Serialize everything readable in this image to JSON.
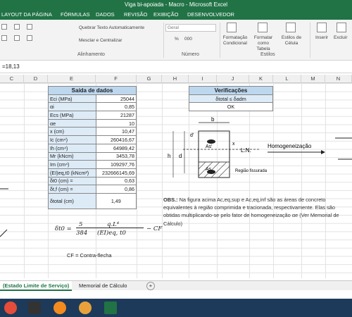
{
  "window": {
    "title": "Viga bi-apoiada - Macro - Microsoft Excel"
  },
  "tabs": [
    "LAYOUT DA PÁGINA",
    "FÓRMULAS",
    "DADOS",
    "REVISÃO",
    "EXIBIÇÃO",
    "DESENVOLVEDOR"
  ],
  "ribbon": {
    "wrap_text": "Quebrar Texto Automaticamente",
    "merge_center": "Mesclar e Centralizar",
    "number_format": "Geral",
    "alignment_group": "Alinhamento",
    "number_group": "Número",
    "conditional_format": "Formatação Condicional",
    "format_as_table": "Formatar como Tabela",
    "cell_styles": "Estilos de Célula",
    "insert": "Inserir",
    "delete": "Excluir",
    "styles_group": "Estilos",
    "percent": "%",
    "thousands": "000"
  },
  "formula": {
    "value": "=18,13"
  },
  "columns": [
    "C",
    "D",
    "E",
    "F",
    "G",
    "H",
    "I",
    "J",
    "K",
    "L",
    "M",
    "N"
  ],
  "output": {
    "title": "Saída de dados",
    "rows": [
      {
        "label": "Eci (MPa)",
        "value": "25044"
      },
      {
        "label": "αi",
        "value": "0,85"
      },
      {
        "label": "Ecs (MPa)",
        "value": "21287"
      },
      {
        "label": "αe",
        "value": "10"
      },
      {
        "label": "x (cm)",
        "value": "10,47"
      },
      {
        "label": "Ic (cm⁴)",
        "value": "260416,67"
      },
      {
        "label": "Ih (cm⁴)",
        "value": "64989,42"
      },
      {
        "label": "Mr (kNcm)",
        "value": "3453,78"
      },
      {
        "label": "Im (cm⁴)",
        "value": "109297,76"
      },
      {
        "label": "(EI)eq,t0 (kNcm²)",
        "value": "232666145,69"
      },
      {
        "label": "δt0 (cm) =",
        "value": "0,63"
      },
      {
        "label": "δt,f (cm) =",
        "value": "0,86"
      }
    ],
    "total_label": "δtotal (cm)",
    "total_value": "1,49"
  },
  "checks": {
    "title": "Verificações",
    "condition": "δtotal ≤ δadm",
    "result": "OK"
  },
  "diagram": {
    "b": "b",
    "d_prime": "d'",
    "as_prime": "As'",
    "x": "x",
    "h": "h",
    "d": "d",
    "ln": "L.N.",
    "as": "As",
    "cracked": "Região fissurada",
    "homog": "Homogeneização"
  },
  "obs": {
    "label": "OBS.:",
    "text": " Na figura acima Ac,eq,sup e Ac,eq,inf são as áreas de concreto equivalentes à região comprimida e tracionada, respectivamente. Elas são obtidas multiplicando-se pelo fator de homogeneização αe (Ver Memorial de Cálculo)"
  },
  "equation": {
    "lhs": "δt0 =",
    "num": "5",
    "num_term": "q.L⁴",
    "den": "384",
    "den_term": "(EI)eq, t0",
    "tail": "− CF"
  },
  "cf_note": "CF = Contra-flecha",
  "sheets": {
    "active": "(Estado Limite de Serviço)",
    "other": "Memorial de Cálculo",
    "add": "+"
  }
}
